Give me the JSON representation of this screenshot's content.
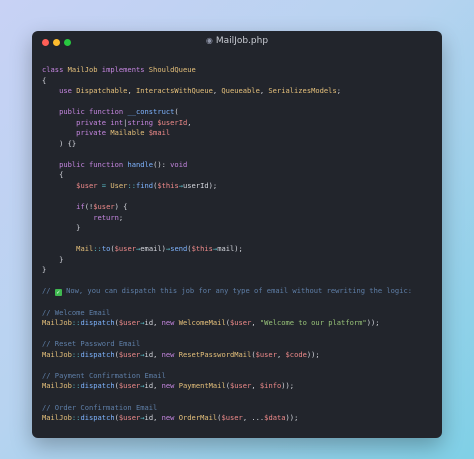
{
  "window": {
    "title": "MailJob.php",
    "file_icon": "php-file-icon"
  },
  "code_lines": [
    [
      [
        "kw",
        "class "
      ],
      [
        "cls",
        "MailJob "
      ],
      [
        "kw",
        "implements "
      ],
      [
        "cls",
        "ShouldQueue"
      ]
    ],
    [
      [
        "plain",
        "{"
      ]
    ],
    [
      [
        "plain",
        "    "
      ],
      [
        "kw",
        "use "
      ],
      [
        "cls",
        "Dispatchable"
      ],
      [
        "plain",
        ", "
      ],
      [
        "cls",
        "InteractsWithQueue"
      ],
      [
        "plain",
        ", "
      ],
      [
        "cls",
        "Queueable"
      ],
      [
        "plain",
        ", "
      ],
      [
        "cls",
        "SerializesModels"
      ],
      [
        "plain",
        ";"
      ]
    ],
    [],
    [
      [
        "plain",
        "    "
      ],
      [
        "kw",
        "public function "
      ],
      [
        "fn",
        "__construct"
      ],
      [
        "plain",
        "("
      ]
    ],
    [
      [
        "plain",
        "        "
      ],
      [
        "kw",
        "private "
      ],
      [
        "kw",
        "int"
      ],
      [
        "plain",
        "|"
      ],
      [
        "kw",
        "string "
      ],
      [
        "var",
        "$userId"
      ],
      [
        "plain",
        ","
      ]
    ],
    [
      [
        "plain",
        "        "
      ],
      [
        "kw",
        "private "
      ],
      [
        "cls",
        "Mailable "
      ],
      [
        "var",
        "$mail"
      ]
    ],
    [
      [
        "plain",
        "    ) {}"
      ]
    ],
    [],
    [
      [
        "plain",
        "    "
      ],
      [
        "kw",
        "public function "
      ],
      [
        "fn",
        "handle"
      ],
      [
        "plain",
        "(): "
      ],
      [
        "kw",
        "void"
      ]
    ],
    [
      [
        "plain",
        "    {"
      ]
    ],
    [
      [
        "plain",
        "        "
      ],
      [
        "var",
        "$user "
      ],
      [
        "op",
        "= "
      ],
      [
        "cls",
        "User"
      ],
      [
        "op",
        "::"
      ],
      [
        "fn",
        "find"
      ],
      [
        "plain",
        "("
      ],
      [
        "var",
        "$this"
      ],
      [
        "op",
        "→"
      ],
      [
        "plain",
        "userId);"
      ]
    ],
    [],
    [
      [
        "plain",
        "        "
      ],
      [
        "kw",
        "if"
      ],
      [
        "plain",
        "(!"
      ],
      [
        "var",
        "$user"
      ],
      [
        "plain",
        ") {"
      ]
    ],
    [
      [
        "plain",
        "            "
      ],
      [
        "kw",
        "return"
      ],
      [
        "plain",
        ";"
      ]
    ],
    [
      [
        "plain",
        "        }"
      ]
    ],
    [],
    [
      [
        "plain",
        "        "
      ],
      [
        "cls",
        "Mail"
      ],
      [
        "op",
        "::"
      ],
      [
        "fn",
        "to"
      ],
      [
        "plain",
        "("
      ],
      [
        "var",
        "$user"
      ],
      [
        "op",
        "→"
      ],
      [
        "plain",
        "email)"
      ],
      [
        "op",
        "→"
      ],
      [
        "fn",
        "send"
      ],
      [
        "plain",
        "("
      ],
      [
        "var",
        "$this"
      ],
      [
        "op",
        "→"
      ],
      [
        "plain",
        "mail);"
      ]
    ],
    [
      [
        "plain",
        "    }"
      ]
    ],
    [
      [
        "plain",
        "}"
      ]
    ],
    [],
    [
      [
        "cmt",
        "// "
      ],
      [
        "check",
        ""
      ],
      [
        "cmt",
        " Now, you can dispatch this job for any type of email without rewriting the logic:"
      ]
    ],
    [],
    [
      [
        "cmt",
        "// Welcome Email"
      ]
    ],
    [
      [
        "cls",
        "MailJob"
      ],
      [
        "op",
        "::"
      ],
      [
        "fn",
        "dispatch"
      ],
      [
        "plain",
        "("
      ],
      [
        "var",
        "$user"
      ],
      [
        "op",
        "→"
      ],
      [
        "plain",
        "id, "
      ],
      [
        "kw",
        "new "
      ],
      [
        "cls",
        "WelcomeMail"
      ],
      [
        "plain",
        "("
      ],
      [
        "var",
        "$user"
      ],
      [
        "plain",
        ", "
      ],
      [
        "str",
        "\"Welcome to our platform\""
      ],
      [
        "plain",
        "));"
      ]
    ],
    [],
    [
      [
        "cmt",
        "// Reset Password Email"
      ]
    ],
    [
      [
        "cls",
        "MailJob"
      ],
      [
        "op",
        "::"
      ],
      [
        "fn",
        "dispatch"
      ],
      [
        "plain",
        "("
      ],
      [
        "var",
        "$user"
      ],
      [
        "op",
        "→"
      ],
      [
        "plain",
        "id, "
      ],
      [
        "kw",
        "new "
      ],
      [
        "cls",
        "ResetPasswordMail"
      ],
      [
        "plain",
        "("
      ],
      [
        "var",
        "$user"
      ],
      [
        "plain",
        ", "
      ],
      [
        "var",
        "$code"
      ],
      [
        "plain",
        "));"
      ]
    ],
    [],
    [
      [
        "cmt",
        "// Payment Confirmation Email"
      ]
    ],
    [
      [
        "cls",
        "MailJob"
      ],
      [
        "op",
        "::"
      ],
      [
        "fn",
        "dispatch"
      ],
      [
        "plain",
        "("
      ],
      [
        "var",
        "$user"
      ],
      [
        "op",
        "→"
      ],
      [
        "plain",
        "id, "
      ],
      [
        "kw",
        "new "
      ],
      [
        "cls",
        "PaymentMail"
      ],
      [
        "plain",
        "("
      ],
      [
        "var",
        "$user"
      ],
      [
        "plain",
        ", "
      ],
      [
        "var",
        "$info"
      ],
      [
        "plain",
        "));"
      ]
    ],
    [],
    [
      [
        "cmt",
        "// Order Confirmation Email"
      ]
    ],
    [
      [
        "cls",
        "MailJob"
      ],
      [
        "op",
        "::"
      ],
      [
        "fn",
        "dispatch"
      ],
      [
        "plain",
        "("
      ],
      [
        "var",
        "$user"
      ],
      [
        "op",
        "→"
      ],
      [
        "plain",
        "id, "
      ],
      [
        "kw",
        "new "
      ],
      [
        "cls",
        "OrderMail"
      ],
      [
        "plain",
        "("
      ],
      [
        "var",
        "$user"
      ],
      [
        "plain",
        ", ..."
      ],
      [
        "var",
        "$data"
      ],
      [
        "plain",
        "));"
      ]
    ]
  ]
}
